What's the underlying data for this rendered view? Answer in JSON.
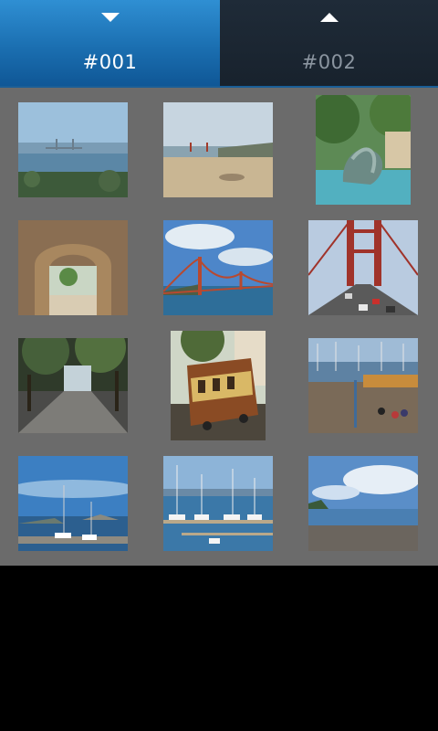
{
  "tabs": [
    {
      "label": "#001",
      "icon": "chevron-down-icon",
      "active": true
    },
    {
      "label": "#002",
      "icon": "chevron-up-icon",
      "active": false
    }
  ],
  "colors": {
    "active_tab": "#1b6fb1",
    "inactive_tab": "#18222d",
    "grid_bg": "#6b6b6b",
    "screen_bg": "#000000"
  },
  "photos": [
    {
      "subject": "bay-view-bridge-distance"
    },
    {
      "subject": "beach-with-bridge"
    },
    {
      "subject": "fountain-sculpture"
    },
    {
      "subject": "stone-archway"
    },
    {
      "subject": "golden-gate-bridge"
    },
    {
      "subject": "bridge-deck-traffic"
    },
    {
      "subject": "shaded-park"
    },
    {
      "subject": "cable-car"
    },
    {
      "subject": "pier-marina"
    },
    {
      "subject": "alcatraz-harbor"
    },
    {
      "subject": "marina-boats"
    },
    {
      "subject": "beach-shoreline"
    }
  ]
}
